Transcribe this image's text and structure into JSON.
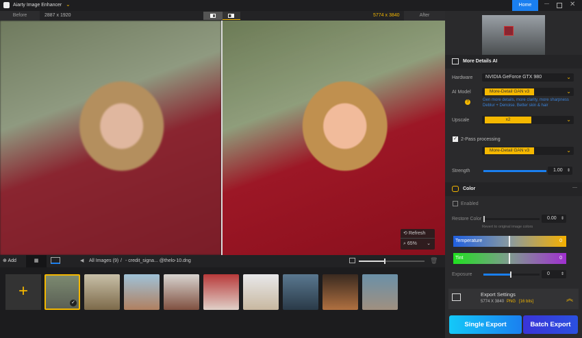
{
  "app": {
    "title": "Aiarty Image Enhancer",
    "home": "Home"
  },
  "toolbar": {
    "before": "Before",
    "before_size": "2887 x 1920",
    "after_size": "5774 x 3840",
    "after": "After"
  },
  "preview": {
    "refresh": "Refresh",
    "zoom": "65%"
  },
  "bottom": {
    "add": "Add",
    "breadcrumb_all": "All Images (9)",
    "breadcrumb_sep": "/",
    "file": "- credit_signa... @thelo-10.dng"
  },
  "panel": {
    "more_details": {
      "title": "More Details AI",
      "hardware_label": "Hardware",
      "hardware": "NVIDIA GeForce GTX 980",
      "model_label": "AI Model",
      "model": "More-Detail GAN  v3",
      "model_desc1": "Gen more details, more clarity, more sharpness",
      "model_desc2": "Deblur + Denoise. Better skin & hair",
      "upscale_label": "Upscale",
      "upscale": "x2",
      "two_pass": "2-Pass processing",
      "two_pass_model": "More-Detail GAN  v3",
      "strength_label": "Strength",
      "strength": "1.00",
      "strength_value": 1.0
    },
    "color": {
      "title": "Color",
      "enabled": "Enabled",
      "restore_label": "Restore Color",
      "restore": "0.00",
      "restore_hint": "Revert to original image colors",
      "temperature": "Temperature",
      "temperature_value": "0",
      "tint": "Tint",
      "tint_value": "0",
      "exposure_label": "Exposure",
      "exposure": "0"
    },
    "export": {
      "title": "Export Settings",
      "size": "5774 X 3840",
      "format": "PNG",
      "bits": "[16 bits]",
      "single": "Single Export",
      "batch": "Batch Export"
    }
  },
  "colors": {
    "accent": "#f5b800",
    "home": "#1a7ff0"
  }
}
